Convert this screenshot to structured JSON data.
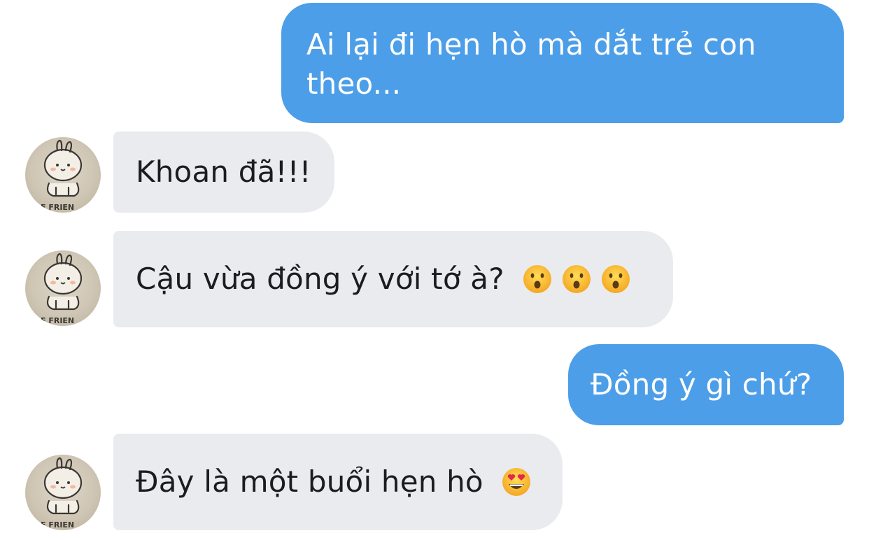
{
  "messages": [
    {
      "side": "outgoing",
      "text": "Ai lại đi hẹn hò mà dắt trẻ con\ntheo..."
    },
    {
      "side": "incoming",
      "text": "Khoan đã!!!"
    },
    {
      "side": "incoming",
      "text": "Cậu vừa đồng ý với tớ à?",
      "emojis": [
        "hushed-face-emoji",
        "hushed-face-emoji",
        "hushed-face-emoji"
      ]
    },
    {
      "side": "outgoing",
      "text": "Đồng ý gì chứ?"
    },
    {
      "side": "incoming",
      "text": "Đây là một buổi hẹn hò",
      "emojis": [
        "heart-eyes-emoji"
      ]
    }
  ],
  "avatar": {
    "icon": "bunny-avatar",
    "caption": "E FRIEN"
  },
  "colors": {
    "outgoing_bubble": "#4c9ee8",
    "incoming_bubble": "#e9ebef",
    "outgoing_text": "#ffffff",
    "incoming_text": "#1c1c1e"
  }
}
